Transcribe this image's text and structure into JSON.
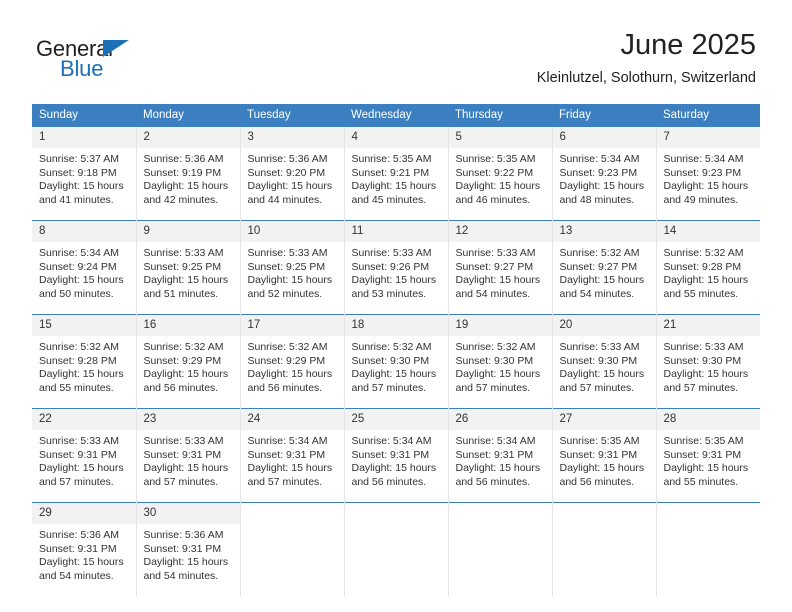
{
  "brand": {
    "line1": "General",
    "line2": "Blue",
    "triangle_icon": "triangle-icon",
    "color_dark": "#221f1f",
    "color_blue": "#1c70b8"
  },
  "header": {
    "month_title": "June 2025",
    "location": "Kleinlutzel, Solothurn, Switzerland"
  },
  "theme": {
    "header_bg": "#3c7fc1",
    "header_text": "#ffffff",
    "daynum_bg": "#f2f2f2",
    "cell_border": "#e4e4e4",
    "row_border": "#3c7fc1"
  },
  "calendar": {
    "weekdays": [
      "Sunday",
      "Monday",
      "Tuesday",
      "Wednesday",
      "Thursday",
      "Friday",
      "Saturday"
    ],
    "weeks": [
      [
        {
          "day": "1",
          "sunrise": "Sunrise: 5:37 AM",
          "sunset": "Sunset: 9:18 PM",
          "daylight_1": "Daylight: 15 hours",
          "daylight_2": "and 41 minutes."
        },
        {
          "day": "2",
          "sunrise": "Sunrise: 5:36 AM",
          "sunset": "Sunset: 9:19 PM",
          "daylight_1": "Daylight: 15 hours",
          "daylight_2": "and 42 minutes."
        },
        {
          "day": "3",
          "sunrise": "Sunrise: 5:36 AM",
          "sunset": "Sunset: 9:20 PM",
          "daylight_1": "Daylight: 15 hours",
          "daylight_2": "and 44 minutes."
        },
        {
          "day": "4",
          "sunrise": "Sunrise: 5:35 AM",
          "sunset": "Sunset: 9:21 PM",
          "daylight_1": "Daylight: 15 hours",
          "daylight_2": "and 45 minutes."
        },
        {
          "day": "5",
          "sunrise": "Sunrise: 5:35 AM",
          "sunset": "Sunset: 9:22 PM",
          "daylight_1": "Daylight: 15 hours",
          "daylight_2": "and 46 minutes."
        },
        {
          "day": "6",
          "sunrise": "Sunrise: 5:34 AM",
          "sunset": "Sunset: 9:23 PM",
          "daylight_1": "Daylight: 15 hours",
          "daylight_2": "and 48 minutes."
        },
        {
          "day": "7",
          "sunrise": "Sunrise: 5:34 AM",
          "sunset": "Sunset: 9:23 PM",
          "daylight_1": "Daylight: 15 hours",
          "daylight_2": "and 49 minutes."
        }
      ],
      [
        {
          "day": "8",
          "sunrise": "Sunrise: 5:34 AM",
          "sunset": "Sunset: 9:24 PM",
          "daylight_1": "Daylight: 15 hours",
          "daylight_2": "and 50 minutes."
        },
        {
          "day": "9",
          "sunrise": "Sunrise: 5:33 AM",
          "sunset": "Sunset: 9:25 PM",
          "daylight_1": "Daylight: 15 hours",
          "daylight_2": "and 51 minutes."
        },
        {
          "day": "10",
          "sunrise": "Sunrise: 5:33 AM",
          "sunset": "Sunset: 9:25 PM",
          "daylight_1": "Daylight: 15 hours",
          "daylight_2": "and 52 minutes."
        },
        {
          "day": "11",
          "sunrise": "Sunrise: 5:33 AM",
          "sunset": "Sunset: 9:26 PM",
          "daylight_1": "Daylight: 15 hours",
          "daylight_2": "and 53 minutes."
        },
        {
          "day": "12",
          "sunrise": "Sunrise: 5:33 AM",
          "sunset": "Sunset: 9:27 PM",
          "daylight_1": "Daylight: 15 hours",
          "daylight_2": "and 54 minutes."
        },
        {
          "day": "13",
          "sunrise": "Sunrise: 5:32 AM",
          "sunset": "Sunset: 9:27 PM",
          "daylight_1": "Daylight: 15 hours",
          "daylight_2": "and 54 minutes."
        },
        {
          "day": "14",
          "sunrise": "Sunrise: 5:32 AM",
          "sunset": "Sunset: 9:28 PM",
          "daylight_1": "Daylight: 15 hours",
          "daylight_2": "and 55 minutes."
        }
      ],
      [
        {
          "day": "15",
          "sunrise": "Sunrise: 5:32 AM",
          "sunset": "Sunset: 9:28 PM",
          "daylight_1": "Daylight: 15 hours",
          "daylight_2": "and 55 minutes."
        },
        {
          "day": "16",
          "sunrise": "Sunrise: 5:32 AM",
          "sunset": "Sunset: 9:29 PM",
          "daylight_1": "Daylight: 15 hours",
          "daylight_2": "and 56 minutes."
        },
        {
          "day": "17",
          "sunrise": "Sunrise: 5:32 AM",
          "sunset": "Sunset: 9:29 PM",
          "daylight_1": "Daylight: 15 hours",
          "daylight_2": "and 56 minutes."
        },
        {
          "day": "18",
          "sunrise": "Sunrise: 5:32 AM",
          "sunset": "Sunset: 9:30 PM",
          "daylight_1": "Daylight: 15 hours",
          "daylight_2": "and 57 minutes."
        },
        {
          "day": "19",
          "sunrise": "Sunrise: 5:32 AM",
          "sunset": "Sunset: 9:30 PM",
          "daylight_1": "Daylight: 15 hours",
          "daylight_2": "and 57 minutes."
        },
        {
          "day": "20",
          "sunrise": "Sunrise: 5:33 AM",
          "sunset": "Sunset: 9:30 PM",
          "daylight_1": "Daylight: 15 hours",
          "daylight_2": "and 57 minutes."
        },
        {
          "day": "21",
          "sunrise": "Sunrise: 5:33 AM",
          "sunset": "Sunset: 9:30 PM",
          "daylight_1": "Daylight: 15 hours",
          "daylight_2": "and 57 minutes."
        }
      ],
      [
        {
          "day": "22",
          "sunrise": "Sunrise: 5:33 AM",
          "sunset": "Sunset: 9:31 PM",
          "daylight_1": "Daylight: 15 hours",
          "daylight_2": "and 57 minutes."
        },
        {
          "day": "23",
          "sunrise": "Sunrise: 5:33 AM",
          "sunset": "Sunset: 9:31 PM",
          "daylight_1": "Daylight: 15 hours",
          "daylight_2": "and 57 minutes."
        },
        {
          "day": "24",
          "sunrise": "Sunrise: 5:34 AM",
          "sunset": "Sunset: 9:31 PM",
          "daylight_1": "Daylight: 15 hours",
          "daylight_2": "and 57 minutes."
        },
        {
          "day": "25",
          "sunrise": "Sunrise: 5:34 AM",
          "sunset": "Sunset: 9:31 PM",
          "daylight_1": "Daylight: 15 hours",
          "daylight_2": "and 56 minutes."
        },
        {
          "day": "26",
          "sunrise": "Sunrise: 5:34 AM",
          "sunset": "Sunset: 9:31 PM",
          "daylight_1": "Daylight: 15 hours",
          "daylight_2": "and 56 minutes."
        },
        {
          "day": "27",
          "sunrise": "Sunrise: 5:35 AM",
          "sunset": "Sunset: 9:31 PM",
          "daylight_1": "Daylight: 15 hours",
          "daylight_2": "and 56 minutes."
        },
        {
          "day": "28",
          "sunrise": "Sunrise: 5:35 AM",
          "sunset": "Sunset: 9:31 PM",
          "daylight_1": "Daylight: 15 hours",
          "daylight_2": "and 55 minutes."
        }
      ],
      [
        {
          "day": "29",
          "sunrise": "Sunrise: 5:36 AM",
          "sunset": "Sunset: 9:31 PM",
          "daylight_1": "Daylight: 15 hours",
          "daylight_2": "and 54 minutes."
        },
        {
          "day": "30",
          "sunrise": "Sunrise: 5:36 AM",
          "sunset": "Sunset: 9:31 PM",
          "daylight_1": "Daylight: 15 hours",
          "daylight_2": "and 54 minutes."
        },
        {
          "day": "",
          "sunrise": "",
          "sunset": "",
          "daylight_1": "",
          "daylight_2": ""
        },
        {
          "day": "",
          "sunrise": "",
          "sunset": "",
          "daylight_1": "",
          "daylight_2": ""
        },
        {
          "day": "",
          "sunrise": "",
          "sunset": "",
          "daylight_1": "",
          "daylight_2": ""
        },
        {
          "day": "",
          "sunrise": "",
          "sunset": "",
          "daylight_1": "",
          "daylight_2": ""
        },
        {
          "day": "",
          "sunrise": "",
          "sunset": "",
          "daylight_1": "",
          "daylight_2": ""
        }
      ]
    ]
  }
}
